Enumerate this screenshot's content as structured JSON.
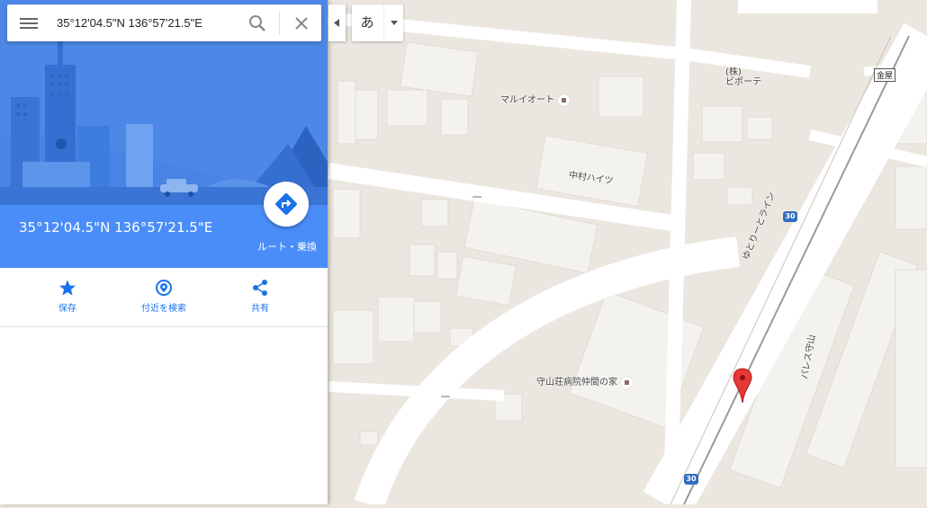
{
  "search": {
    "value": "35°12'04.5\"N 136°57'21.5\"E",
    "menu_icon": "hamburger-menu-icon",
    "search_icon": "magnifier-icon",
    "clear_icon": "close-icon"
  },
  "ime": {
    "char": "あ"
  },
  "place": {
    "title": "35°12'04.5\"N 136°57'21.5\"E",
    "route_label": "ルート・乗換"
  },
  "actions": [
    {
      "label": "保存",
      "icon": "star-icon"
    },
    {
      "label": "付近を検索",
      "icon": "nearby-pin-icon"
    },
    {
      "label": "共有",
      "icon": "share-icon"
    }
  ],
  "map": {
    "labels": {
      "maruiote": "マルイオート",
      "bipote_1": "(株)",
      "bipote_2": "ビポーテ",
      "nakamura": "中村ハイツ",
      "hospital": "守山荘病院仲間の家",
      "yutori": "ゆとりーとライン",
      "palace": "パレス守山",
      "station": "金屋"
    },
    "route_number": "30",
    "colors": {
      "road": "#ffffff",
      "block": "#e8e3dc",
      "building": "#f4f2ee",
      "pin": "#e53935"
    }
  }
}
